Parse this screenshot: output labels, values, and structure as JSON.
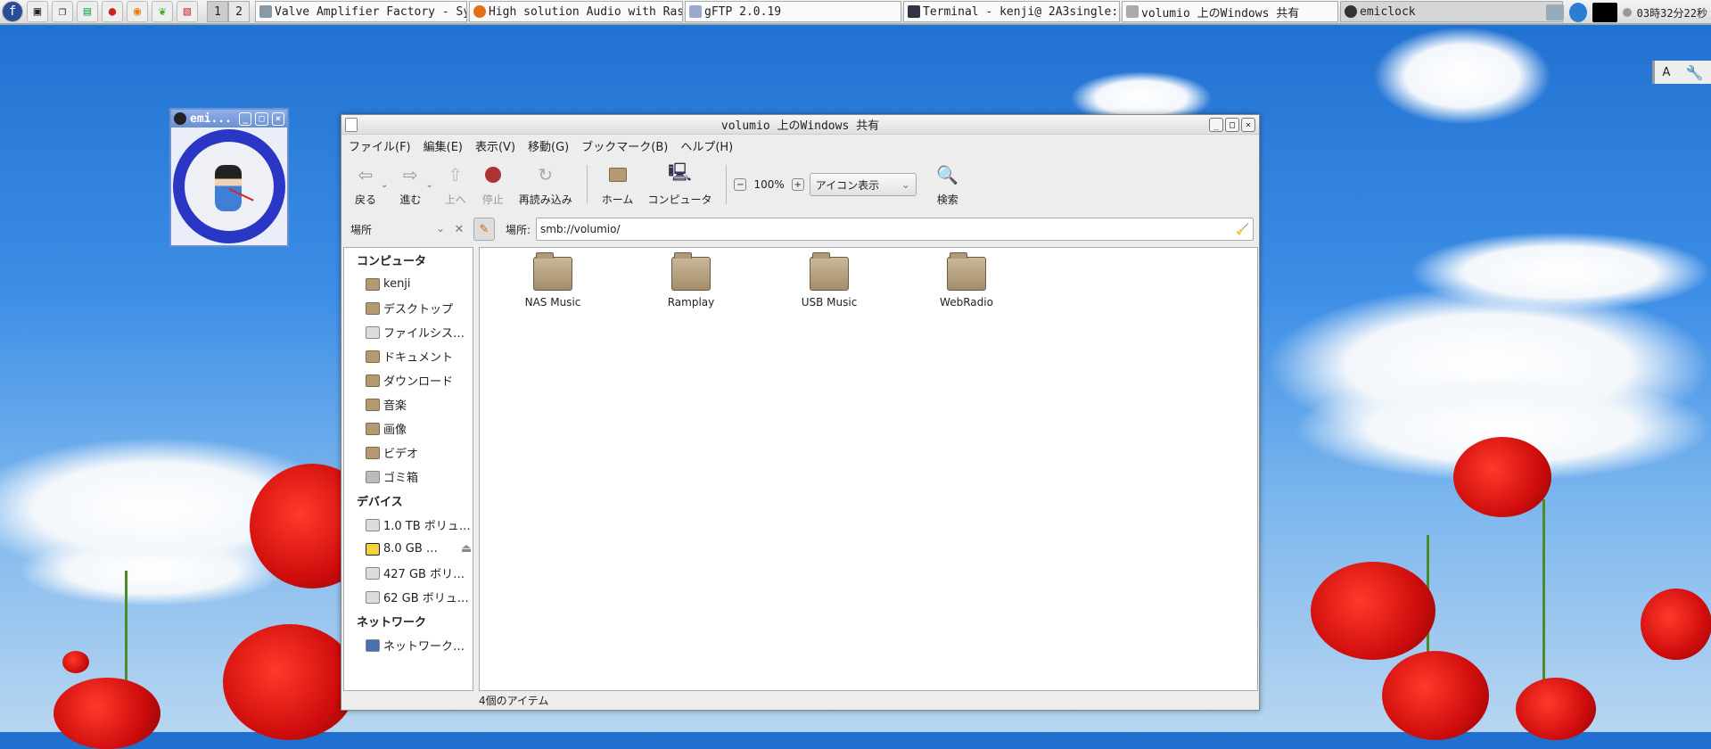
{
  "taskbar": {
    "launchers": [
      "fedora-icon",
      "app-icon",
      "window-list-icon",
      "terminal-icon",
      "browser-icon",
      "firefox-icon",
      "leaf-icon",
      "document-icon"
    ],
    "workspaces": [
      "1",
      "2"
    ],
    "tasks": [
      {
        "label": "Valve Amplifier Factory - Sy...",
        "icon": "document-icon",
        "color": "#8899aa"
      },
      {
        "label": "High solution Audio with Ras...",
        "icon": "firefox-icon",
        "color": "#e0701a"
      },
      {
        "label": "gFTP 2.0.19",
        "icon": "gftp-icon",
        "color": "#99aacc"
      },
      {
        "label": "Terminal - kenji@ 2A3single:...",
        "icon": "terminal-icon",
        "color": "#334"
      },
      {
        "label": "volumio 上のWindows 共有",
        "icon": "file-manager-icon",
        "color": "#aaa"
      },
      {
        "label": "emiclock",
        "icon": "emiclock-icon",
        "color": "#333"
      }
    ],
    "clock": "03時32分22秒"
  },
  "emiclock": {
    "title": "emi..."
  },
  "corner_panel": {
    "label": "A"
  },
  "window": {
    "title": "volumio 上のWindows 共有",
    "menu": [
      "ファイル(F)",
      "編集(E)",
      "表示(V)",
      "移動(G)",
      "ブックマーク(B)",
      "ヘルプ(H)"
    ],
    "toolbar": {
      "back": "戻る",
      "forward": "進む",
      "up": "上へ",
      "stop": "停止",
      "reload": "再読み込み",
      "home": "ホーム",
      "computer": "コンピュータ",
      "zoom": "100%",
      "view_mode": "アイコン表示",
      "search": "検索"
    },
    "location": {
      "sidebar_select": "場所",
      "label": "場所:",
      "path": "smb://volumio/"
    },
    "sidebar": [
      {
        "heading": "コンピュータ",
        "items": [
          "kenji",
          "デスクトップ",
          "ファイルシス…",
          "ドキュメント",
          "ダウンロード",
          "音楽",
          "画像",
          "ビデオ",
          "ゴミ箱"
        ]
      },
      {
        "heading": "デバイス",
        "items": [
          "1.0 TB ボリュ…",
          "8.0 GB …",
          "427 GB ボリ…",
          "62 GB ボリュ…"
        ]
      },
      {
        "heading": "ネットワーク",
        "items": [
          "ネットワーク…"
        ]
      }
    ],
    "files": [
      "NAS Music",
      "Ramplay",
      "USB Music",
      "WebRadio"
    ],
    "status": "4個のアイテム"
  }
}
